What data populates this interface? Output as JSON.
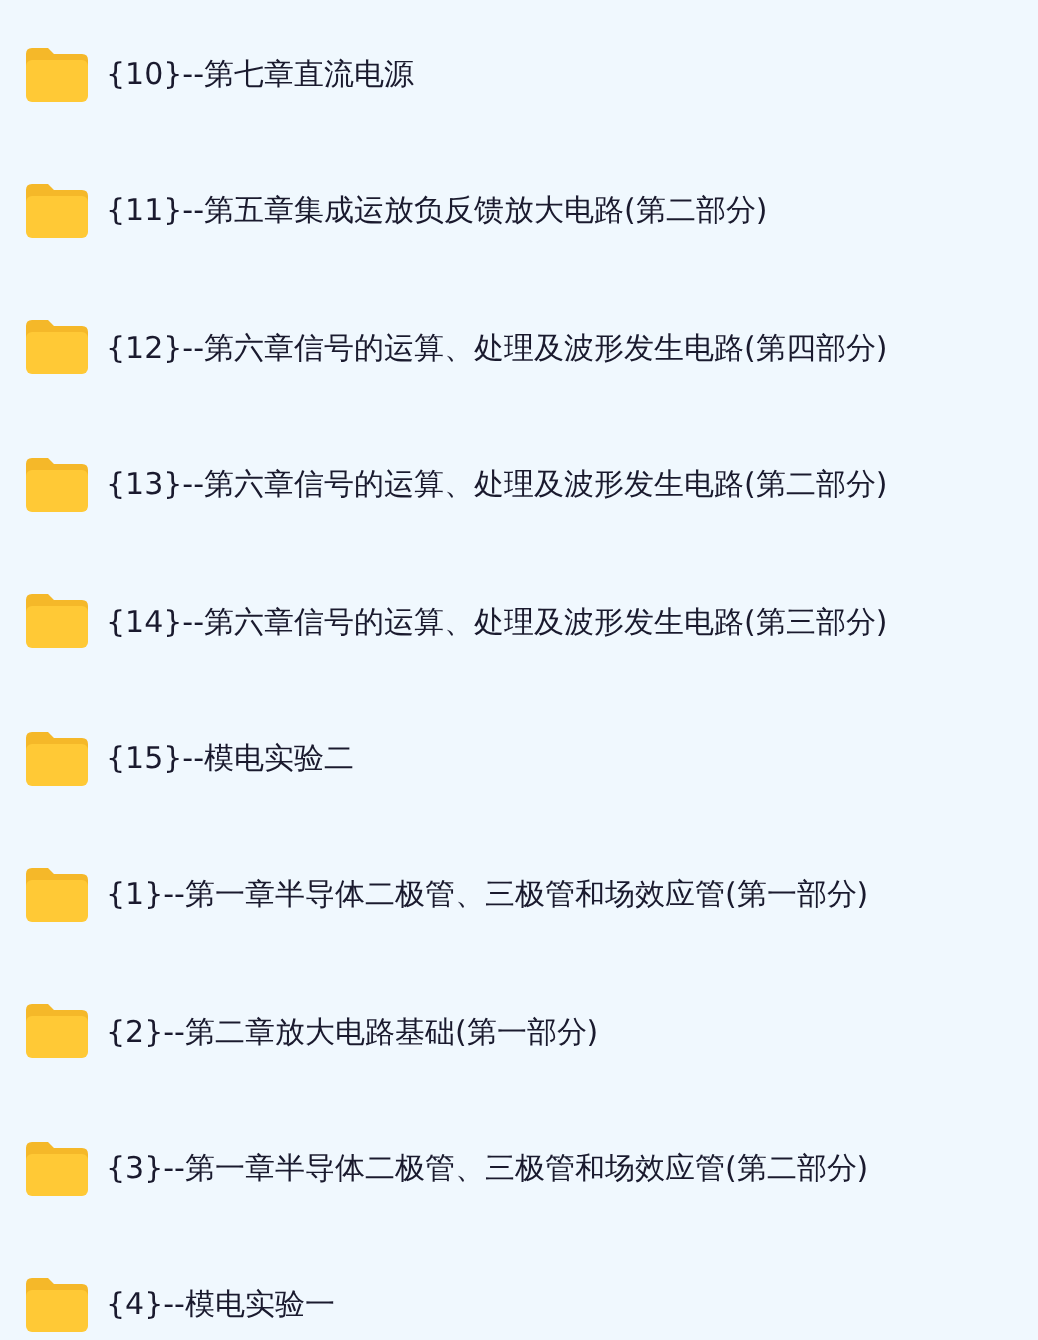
{
  "folders": [
    {
      "name": "{10}--第七章直流电源"
    },
    {
      "name": "{11}--第五章集成运放负反馈放大电路(第二部分)"
    },
    {
      "name": "{12}--第六章信号的运算、处理及波形发生电路(第四部分)"
    },
    {
      "name": "{13}--第六章信号的运算、处理及波形发生电路(第二部分)"
    },
    {
      "name": "{14}--第六章信号的运算、处理及波形发生电路(第三部分)"
    },
    {
      "name": "{15}--模电实验二"
    },
    {
      "name": "{1}--第一章半导体二极管、三极管和场效应管(第一部分)"
    },
    {
      "name": "{2}--第二章放大电路基础(第一部分)"
    },
    {
      "name": "{3}--第一章半导体二极管、三极管和场效应管(第二部分)"
    },
    {
      "name": "{4}--模电实验一"
    }
  ]
}
